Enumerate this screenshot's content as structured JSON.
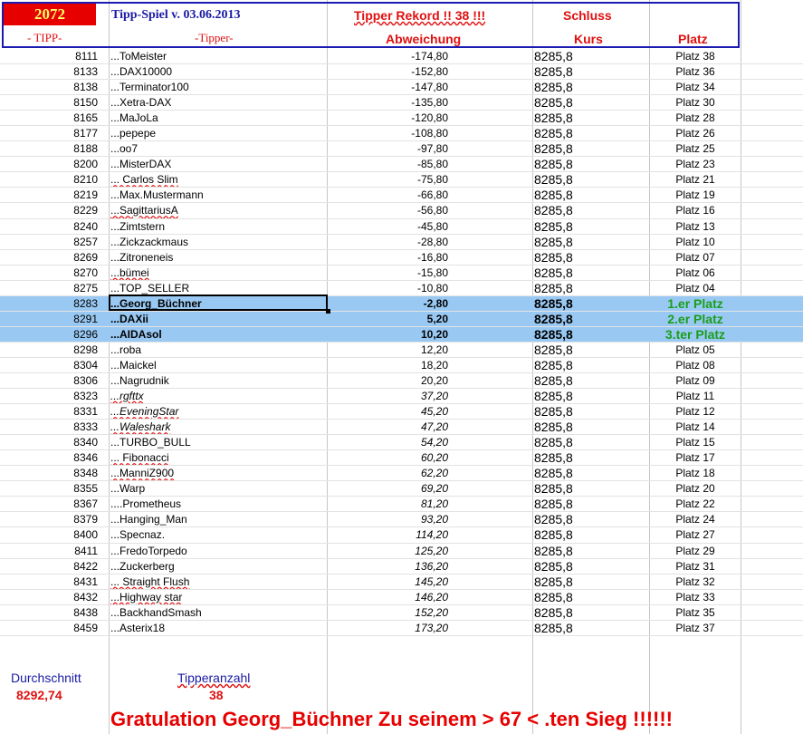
{
  "header": {
    "number": "2072",
    "tipp_label": "- TIPP-",
    "title": "Tipp-Spiel v. 03.06.2013",
    "tipper_label": "-Tipper-",
    "rekord": "Tipper Rekord !!  38  !!!",
    "abweichung_label": "Abweichung",
    "schluss_label": "Schluss",
    "kurs_label": "Kurs",
    "platz_label": "Platz"
  },
  "rows": [
    {
      "tipp": "8111",
      "name": "...ToMeister",
      "abw": "-174,80",
      "kurs": "8285,8",
      "platz": "Platz 38"
    },
    {
      "tipp": "8133",
      "name": "...DAX10000",
      "abw": "-152,80",
      "kurs": "8285,8",
      "platz": "Platz 36"
    },
    {
      "tipp": "8138",
      "name": "...Terminator100",
      "abw": "-147,80",
      "kurs": "8285,8",
      "platz": "Platz 34"
    },
    {
      "tipp": "8150",
      "name": "...Xetra-DAX",
      "abw": "-135,80",
      "kurs": "8285,8",
      "platz": "Platz 30"
    },
    {
      "tipp": "8165",
      "name": "...MaJoLa",
      "abw": "-120,80",
      "kurs": "8285,8",
      "platz": "Platz 28"
    },
    {
      "tipp": "8177",
      "name": "...pepepe",
      "abw": "-108,80",
      "kurs": "8285,8",
      "platz": "Platz 26"
    },
    {
      "tipp": "8188",
      "name": "...oo7",
      "abw": "-97,80",
      "kurs": "8285,8",
      "platz": "Platz 25"
    },
    {
      "tipp": "8200",
      "name": "...MisterDAX",
      "abw": "-85,80",
      "kurs": "8285,8",
      "platz": "Platz 23"
    },
    {
      "tipp": "8210",
      "name": "... Carlos Slim",
      "abw": "-75,80",
      "kurs": "8285,8",
      "platz": "Platz 21"
    },
    {
      "tipp": "8219",
      "name": "...Max.Mustermann",
      "abw": "-66,80",
      "kurs": "8285,8",
      "platz": "Platz 19"
    },
    {
      "tipp": "8229",
      "name": "...SagittariusA",
      "abw": "-56,80",
      "kurs": "8285,8",
      "platz": "Platz 16"
    },
    {
      "tipp": "8240",
      "name": "...Zimtstern",
      "abw": "-45,80",
      "kurs": "8285,8",
      "platz": "Platz 13"
    },
    {
      "tipp": "8257",
      "name": "...Zickzackmaus",
      "abw": "-28,80",
      "kurs": "8285,8",
      "platz": "Platz 10"
    },
    {
      "tipp": "8269",
      "name": "...Zitroneneis",
      "abw": "-16,80",
      "kurs": "8285,8",
      "platz": "Platz 07"
    },
    {
      "tipp": "8270",
      "name": "...bümei",
      "abw": "-15,80",
      "kurs": "8285,8",
      "platz": "Platz 06"
    },
    {
      "tipp": "8275",
      "name": "...TOP_SELLER",
      "abw": "-10,80",
      "kurs": "8285,8",
      "platz": "Platz 04"
    },
    {
      "tipp": "8283",
      "name": "...Georg_Büchner",
      "abw": "-2,80",
      "kurs": "8285,8",
      "platz": "1.er Platz"
    },
    {
      "tipp": "8291",
      "name": "...DAXii",
      "abw": "5,20",
      "kurs": "8285,8",
      "platz": "2.er Platz"
    },
    {
      "tipp": "8296",
      "name": "...AIDAsol",
      "abw": "10,20",
      "kurs": "8285,8",
      "platz": "3.ter Platz"
    },
    {
      "tipp": "8298",
      "name": "...roba",
      "abw": "12,20",
      "kurs": "8285,8",
      "platz": "Platz 05"
    },
    {
      "tipp": "8304",
      "name": "...Maickel",
      "abw": "18,20",
      "kurs": "8285,8",
      "platz": "Platz 08"
    },
    {
      "tipp": "8306",
      "name": "...Nagrudnik",
      "abw": "20,20",
      "kurs": "8285,8",
      "platz": "Platz 09"
    },
    {
      "tipp": "8323",
      "name": "...rgfttx",
      "abw": "37,20",
      "kurs": "8285,8",
      "platz": "Platz 11"
    },
    {
      "tipp": "8331",
      "name": "...EveningStar",
      "abw": "45,20",
      "kurs": "8285,8",
      "platz": "Platz 12"
    },
    {
      "tipp": "8333",
      "name": "...Waleshark",
      "abw": "47,20",
      "kurs": "8285,8",
      "platz": "Platz 14"
    },
    {
      "tipp": "8340",
      "name": "...TURBO_BULL",
      "abw": "54,20",
      "kurs": "8285,8",
      "platz": "Platz 15"
    },
    {
      "tipp": "8346",
      "name": "... Fibonacci",
      "abw": "60,20",
      "kurs": "8285,8",
      "platz": "Platz 17"
    },
    {
      "tipp": "8348",
      "name": "...ManniZ900",
      "abw": "62,20",
      "kurs": "8285,8",
      "platz": "Platz 18"
    },
    {
      "tipp": "8355",
      "name": "...Warp",
      "abw": "69,20",
      "kurs": "8285,8",
      "platz": "Platz 20"
    },
    {
      "tipp": "8367",
      "name": "....Prometheus",
      "abw": "81,20",
      "kurs": "8285,8",
      "platz": "Platz 22"
    },
    {
      "tipp": "8379",
      "name": "...Hanging_Man",
      "abw": "93,20",
      "kurs": "8285,8",
      "platz": "Platz 24"
    },
    {
      "tipp": "8400",
      "name": "...Specnaz.",
      "abw": "114,20",
      "kurs": "8285,8",
      "platz": "Platz 27"
    },
    {
      "tipp": "8411",
      "name": "...FredoTorpedo",
      "abw": "125,20",
      "kurs": "8285,8",
      "platz": "Platz 29"
    },
    {
      "tipp": "8422",
      "name": "...Zuckerberg",
      "abw": "136,20",
      "kurs": "8285,8",
      "platz": "Platz 31"
    },
    {
      "tipp": "8431",
      "name": "... Straight Flush",
      "abw": "145,20",
      "kurs": "8285,8",
      "platz": "Platz 32"
    },
    {
      "tipp": "8432",
      "name": "...Highway star",
      "abw": "146,20",
      "kurs": "8285,8",
      "platz": "Platz 33"
    },
    {
      "tipp": "8438",
      "name": "...BackhandSmash",
      "abw": "152,20",
      "kurs": "8285,8",
      "platz": "Platz 35"
    },
    {
      "tipp": "8459",
      "name": "...Asterix18",
      "abw": "173,20",
      "kurs": "8285,8",
      "platz": "Platz 37"
    }
  ],
  "footer": {
    "durchschnitt_label": "Durchschnitt",
    "durchschnitt_value": "8292,74",
    "tipperanzahl_label": "Tipperanzahl",
    "tipperanzahl_value": "38",
    "congrats": "Gratulation Georg_Büchner  Zu seinem > 67 < .ten Sieg !!!!!!"
  },
  "colors": {
    "highlight": "#99c9f3",
    "header_border": "#1b1bb0",
    "red": "#e01010",
    "green": "#1a9e1a"
  }
}
